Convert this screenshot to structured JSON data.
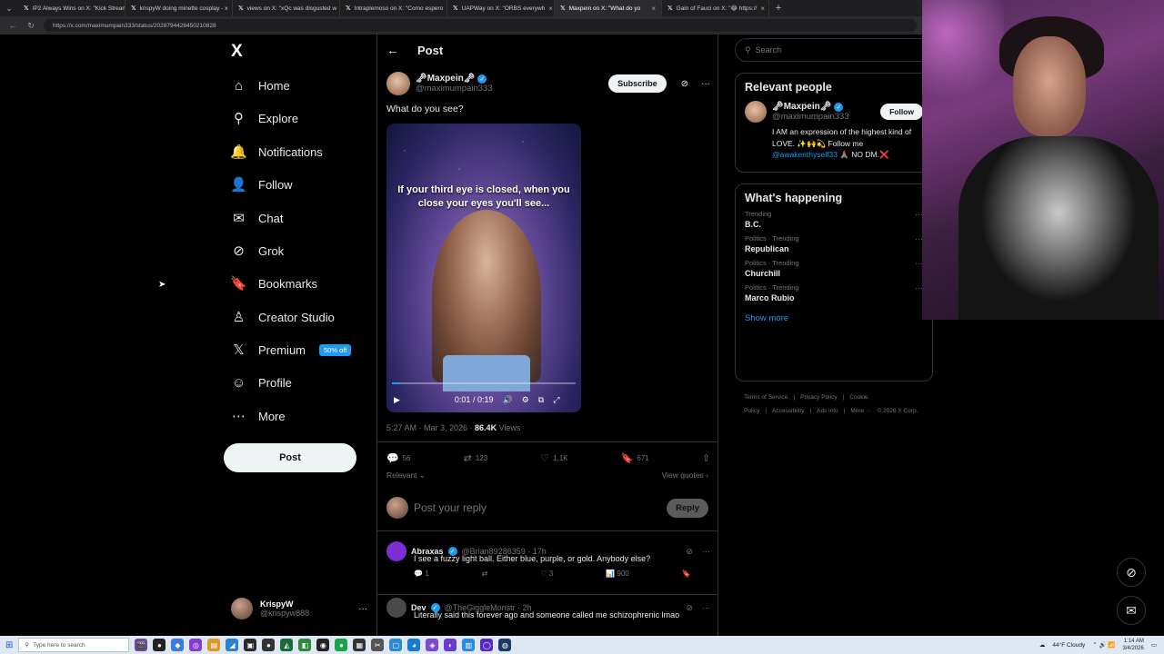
{
  "browser": {
    "tabs": [
      {
        "label": "IP2 Always Wins on X: \"Kick Stream",
        "active": false
      },
      {
        "label": "krispyW doing minette cosplay - x",
        "active": false
      },
      {
        "label": "views on X: \"xQc was disgusted w",
        "active": false
      },
      {
        "label": "Intraplemoso on X: \"Como espero",
        "active": false
      },
      {
        "label": "UAPWay on X: \"ORBS everywh",
        "active": false
      },
      {
        "label": "Maxpein on X: \"What do yo",
        "active": true
      },
      {
        "label": "Gain of Fauci on X: \"😂 https://",
        "active": false
      }
    ],
    "url": "https://x.com/maximumpain333/status/2028794426450210828"
  },
  "leftnav": {
    "logo": "X",
    "items": [
      {
        "label": "Home",
        "icon": "home-icon",
        "glyph": "⌂",
        "bold": false
      },
      {
        "label": "Explore",
        "icon": "search-icon",
        "glyph": "⚲",
        "bold": false
      },
      {
        "label": "Notifications",
        "icon": "bell-icon",
        "glyph": "🔔",
        "bold": false
      },
      {
        "label": "Follow",
        "icon": "add-person-icon",
        "glyph": "👤",
        "bold": false
      },
      {
        "label": "Chat",
        "icon": "mail-icon",
        "glyph": "✉",
        "bold": false
      },
      {
        "label": "Grok",
        "icon": "grok-icon",
        "glyph": "⊘",
        "bold": false
      },
      {
        "label": "Bookmarks",
        "icon": "bookmark-icon",
        "glyph": "🔖",
        "bold": false
      },
      {
        "label": "Creator Studio",
        "icon": "creator-studio-icon",
        "glyph": "♙",
        "bold": false
      },
      {
        "label": "Premium",
        "icon": "x-premium-icon",
        "glyph": "𝕏",
        "bold": false
      },
      {
        "label": "Profile",
        "icon": "profile-icon",
        "glyph": "☺",
        "bold": false
      },
      {
        "label": "More",
        "icon": "more-circle-icon",
        "glyph": "⋯",
        "bold": false
      }
    ],
    "premium_badge": "50% off",
    "post_button": "Post",
    "account": {
      "name": "KrispyW",
      "handle": "@krispyw888",
      "more": "···"
    }
  },
  "post": {
    "header_title": "Post",
    "author_name": "🗝Maxpein🗝",
    "author_handle": "@maximumpain333",
    "subscribe_label": "Subscribe",
    "text": "What do you see?",
    "video": {
      "caption": "If your third eye is closed, when you close your eyes you'll see...",
      "time": "0:01 / 0:19",
      "progress": 0.05
    },
    "meta_time": "5:27 AM · Mar 3, 2026 · ",
    "meta_views_value": "86.4K",
    "meta_views_label": " Views",
    "stats": {
      "replies": "56",
      "reposts": "123",
      "likes": "1.1K",
      "bookmarks": "671"
    },
    "sort_label": "Relevant ⌄",
    "view_quotes": "View quotes ›",
    "reply_placeholder": "Post your reply",
    "reply_button": "Reply"
  },
  "replies": [
    {
      "name": "Abraxas",
      "handle": "@Brian89286359 · 17h",
      "text": "I see a fuzzy light ball.  Either blue, purple, or gold.  Anybody else?",
      "replies": "1",
      "likes": "3",
      "views": "900",
      "avatar_color": "#7b2fd0"
    },
    {
      "name": "Dev",
      "handle": "@TheGiggleMonstr · 2h",
      "text": "Literally said this forever ago and someone called me schizophrenic lmao",
      "avatar_color": "#4a4a4a"
    }
  ],
  "right": {
    "search_placeholder": "Search",
    "relevant": {
      "title": "Relevant people",
      "name": "🗝Maxpein🗝",
      "handle": "@maximumpain333",
      "follow_label": "Follow",
      "bio_text": "I AM an expression of the highest kind of LOVE. ✨🙌💫 Follow me ",
      "bio_link": "@awakenthyself33",
      "bio_tail": " 🙏🏽 NO DM.❌"
    },
    "happening": {
      "title": "What's happening",
      "trends": [
        {
          "category": "Trending",
          "name": "B.C."
        },
        {
          "category": "Politics · Trending",
          "name": "Republican"
        },
        {
          "category": "Politics · Trending",
          "name": "Churchill"
        },
        {
          "category": "Politics · Trending",
          "name": "Marco Rubio"
        }
      ],
      "show_more": "Show more"
    },
    "footer": [
      "Terms of Service",
      "|",
      "Privacy Policy",
      "|",
      "Cookie Policy",
      "|",
      "Accessibility",
      "|",
      "Ads info",
      "|",
      "More ···",
      "© 2026 X Corp."
    ]
  },
  "taskbar": {
    "search_placeholder": "Type here to search",
    "weather": "44°F  Cloudy",
    "time": "1:14 AM",
    "date": "3/4/2026"
  },
  "colors": {
    "accent": "#1d9bf0",
    "background": "#000000",
    "border": "#2f3336",
    "muted": "#71767b"
  }
}
